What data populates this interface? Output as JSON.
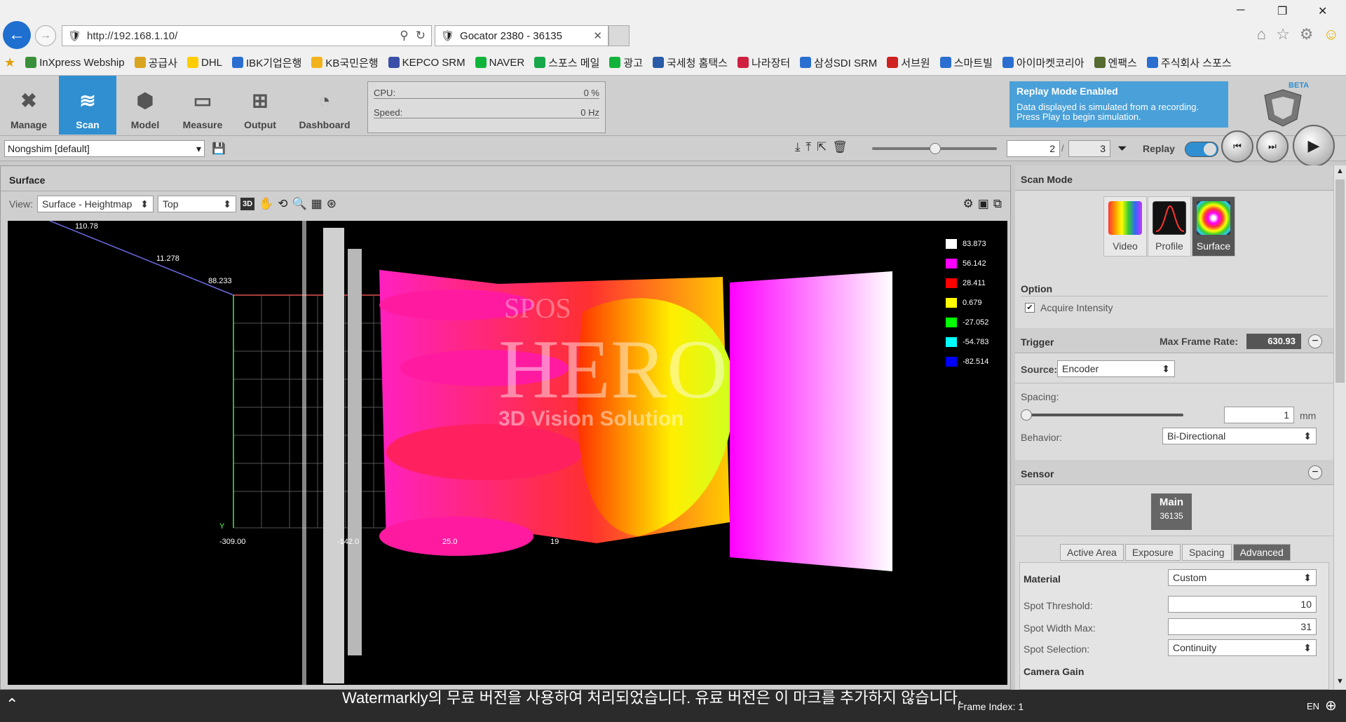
{
  "browser": {
    "url": "http://192.168.1.10/",
    "tab_title": "Gocator 2380 - 36135"
  },
  "favorites": [
    "InXpress Webship",
    "공급사",
    "DHL",
    "IBK기업은행",
    "KB국민은행",
    "KEPCO SRM",
    "NAVER",
    "스포스 메일",
    "광고",
    "국세청 홈택스",
    "나라장터",
    "삼성SDI SRM",
    "서브원",
    "스마트빌",
    "아이마켓코리아",
    "엔팩스",
    "주식회사 스포스"
  ],
  "nav": [
    "Manage",
    "Scan",
    "Model",
    "Measure",
    "Output",
    "Dashboard"
  ],
  "stats": {
    "cpu_label": "CPU:",
    "cpu_value": "0 %",
    "speed_label": "Speed:",
    "speed_value": "0 Hz"
  },
  "replay_banner": {
    "title": "Replay Mode Enabled",
    "line1": "Data displayed is simulated from a recording.",
    "line2": "Press Play to begin simulation."
  },
  "logo_badge": "BETA",
  "job": "Nongshim [default]",
  "frame": {
    "current": "2",
    "total": "3"
  },
  "replay_label": "Replay",
  "surface": {
    "title": "Surface",
    "view_label": "View:",
    "view_type": "Surface - Heightmap",
    "orientation": "Top",
    "mode_3d": "3D"
  },
  "legend": [
    {
      "value": "83.873",
      "color": "#ffffff"
    },
    {
      "value": "56.142",
      "color": "#ff00ff"
    },
    {
      "value": "28.411",
      "color": "#ff0000"
    },
    {
      "value": "0.679",
      "color": "#ffff00"
    },
    {
      "value": "-27.052",
      "color": "#00ff00"
    },
    {
      "value": "-54.783",
      "color": "#00ffff"
    },
    {
      "value": "-82.514",
      "color": "#0000ff"
    }
  ],
  "axis_labels": {
    "a": "110.78",
    "b": "11.278",
    "c": "88.233",
    "y": "Y",
    "x0": "-309.00",
    "x1": "-142.0",
    "x2": "25.0",
    "x3": "19"
  },
  "overlay_text": {
    "brand_small": "SPOS",
    "brand_big": "HERO",
    "tagline": "3D Vision Solution"
  },
  "scan_mode": {
    "title": "Scan Mode",
    "modes": [
      "Video",
      "Profile",
      "Surface"
    ],
    "option_title": "Option",
    "acquire_intensity": "Acquire Intensity"
  },
  "trigger": {
    "title": "Trigger",
    "max_rate_label": "Max Frame Rate:",
    "max_rate": "630.93",
    "source_label": "Source:",
    "source": "Encoder",
    "spacing_label": "Spacing:",
    "spacing_value": "1",
    "spacing_unit": "mm",
    "behavior_label": "Behavior:",
    "behavior": "Bi-Directional"
  },
  "sensor": {
    "title": "Sensor",
    "main": "Main",
    "serial": "36135",
    "tabs": [
      "Active Area",
      "Exposure",
      "Spacing",
      "Advanced"
    ],
    "material_label": "Material",
    "material": "Custom",
    "spot_threshold_label": "Spot Threshold:",
    "spot_threshold": "10",
    "spot_width_label": "Spot Width Max:",
    "spot_width": "31",
    "spot_sel_label": "Spot Selection:",
    "spot_sel": "Continuity",
    "camera_gain": "Camera Gain"
  },
  "status": {
    "frame_index": "Frame Index: 1",
    "lang": "EN"
  },
  "watermark": "Watermarkly의 무료 버전을 사용하여 처리되었습니다. 유료 버전은 이 마크를 추가하지 않습니다."
}
